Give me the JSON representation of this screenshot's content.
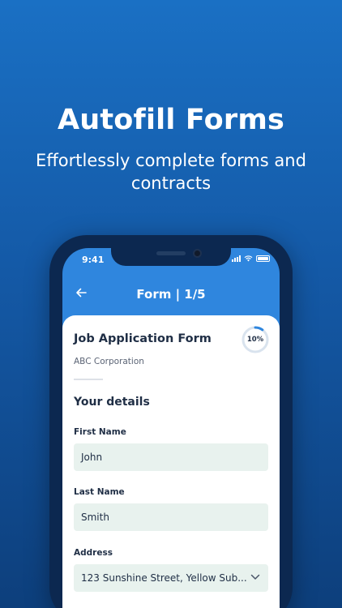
{
  "promo": {
    "headline": "Autofill Forms",
    "subline": "Effortlessly complete forms and contracts"
  },
  "status_bar": {
    "time": "9:41"
  },
  "header": {
    "title": "Form | 1/5",
    "back_icon": "arrow-left-icon"
  },
  "form": {
    "title": "Job Application Form",
    "company": "ABC Corporation",
    "progress_label": "10%",
    "progress_fraction": 0.1,
    "section_title": "Your details",
    "fields": [
      {
        "label": "First Name",
        "value": "John"
      },
      {
        "label": "Last Name",
        "value": "Smith"
      },
      {
        "label": "Address",
        "value": "123 Sunshine Street, Yellow Sub..."
      }
    ]
  },
  "colors": {
    "accent": "#2f86de",
    "field_bg": "#e8f2ee",
    "text_dark": "#1f2e45"
  }
}
